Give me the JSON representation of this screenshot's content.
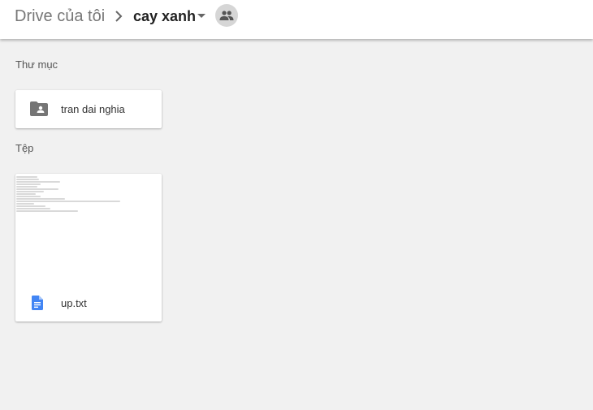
{
  "header": {
    "root_label": "Drive của tôi",
    "current_folder": "cay xanh",
    "separator_icon": "chevron-right-icon",
    "caret_icon": "caret-down-icon",
    "shared_icon": "people-icon"
  },
  "sections": {
    "folders_label": "Thư mục",
    "files_label": "Tệp"
  },
  "folders": [
    {
      "name": "tran dai nghia",
      "icon": "shared-folder-icon",
      "icon_color": "#757575"
    }
  ],
  "files": [
    {
      "name": "up.txt",
      "icon": "text-document-icon",
      "icon_color": "#4285f4"
    }
  ],
  "colors": {
    "background": "#f1f1f1",
    "header": "#ffffff",
    "accent_blue": "#4285f4"
  }
}
